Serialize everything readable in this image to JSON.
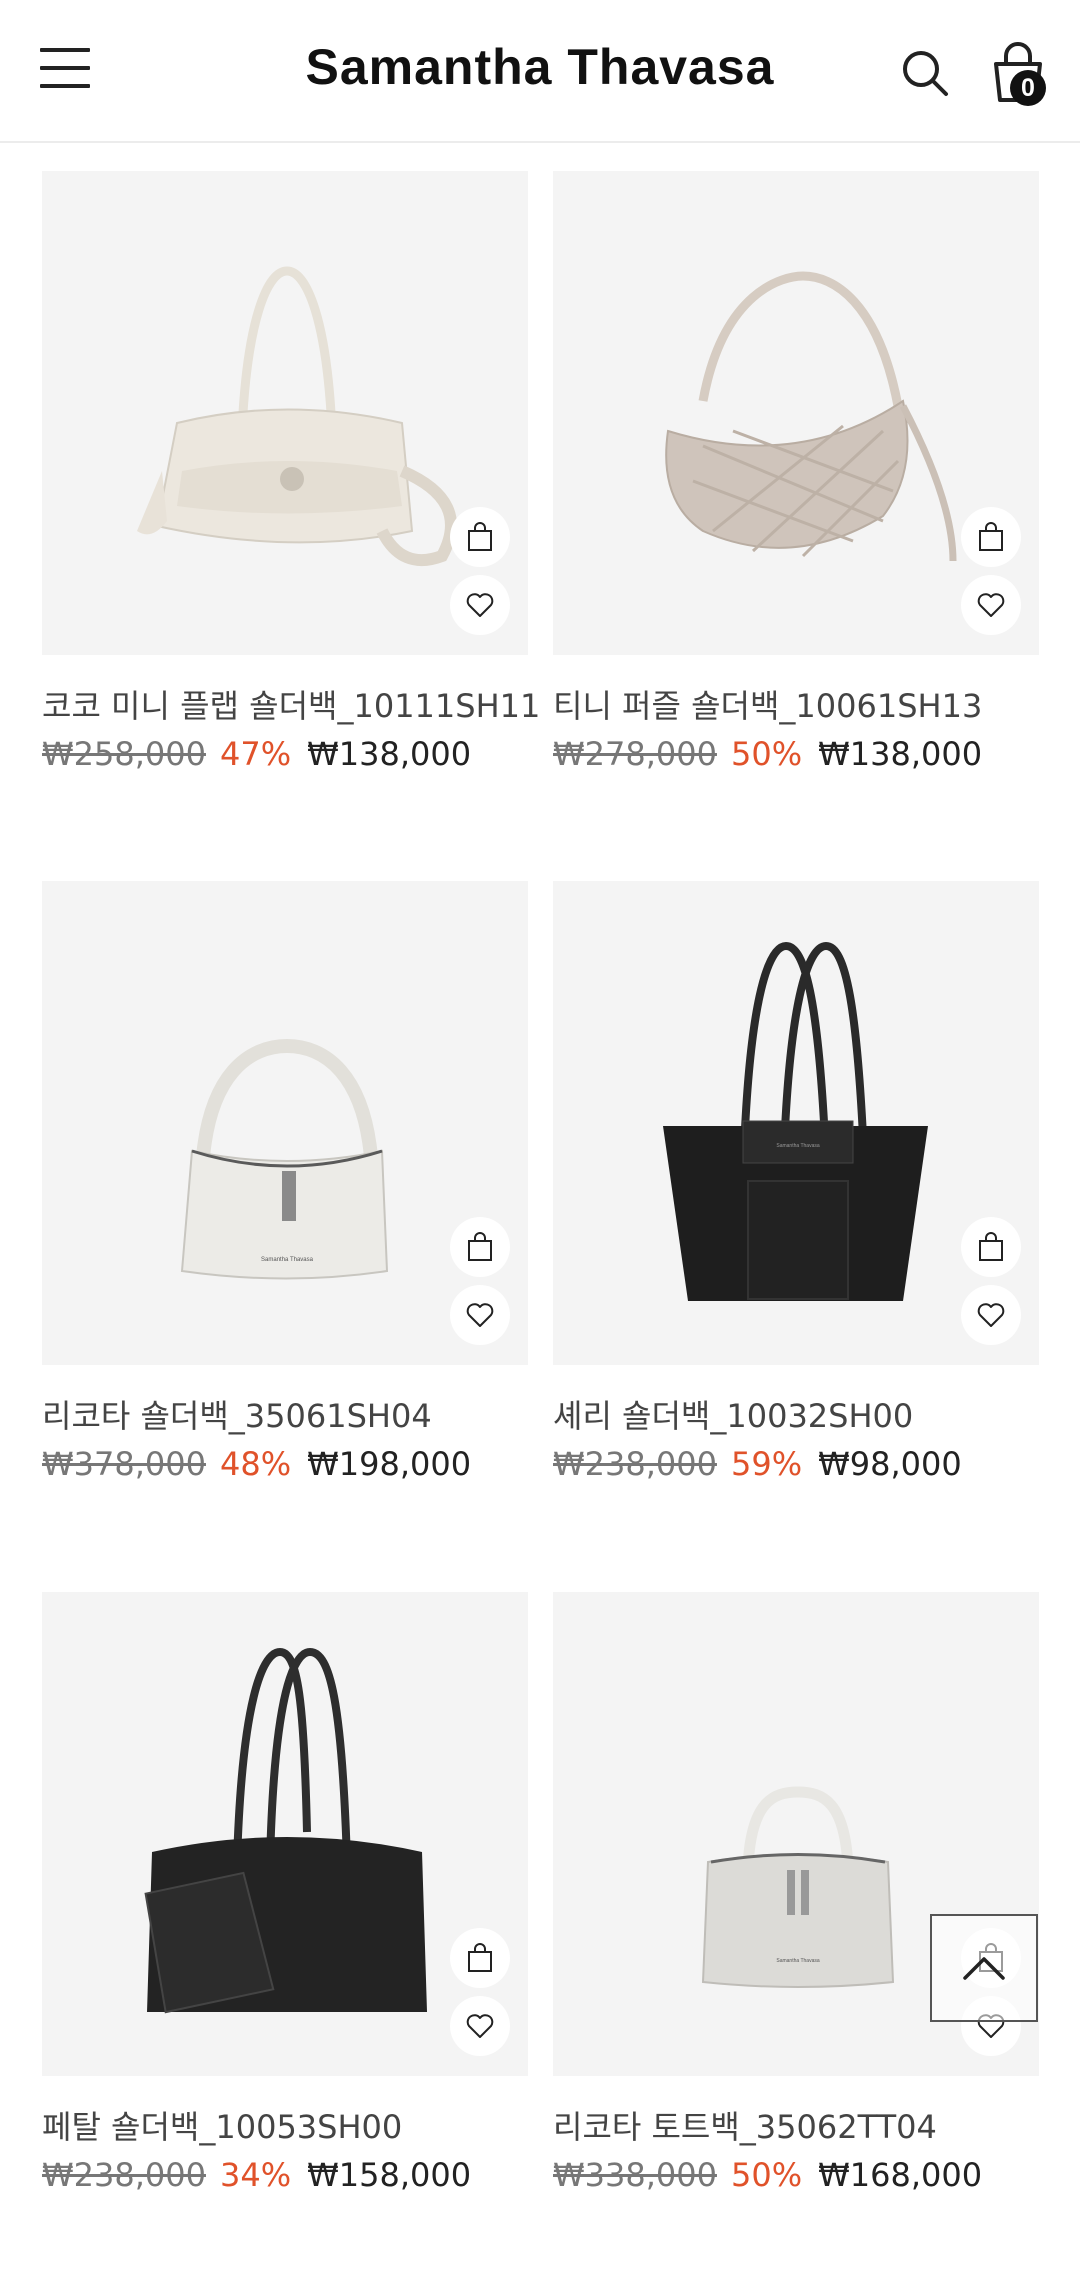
{
  "header": {
    "logo": "Samantha Thavasa",
    "cart_count": "0"
  },
  "products": [
    {
      "name": "코코 미니 플랩 숄더백_10111SH11",
      "original_price": "₩258,000",
      "discount": "47%",
      "sale_price": "₩138,000",
      "color": "#ece7de"
    },
    {
      "name": "티니 퍼즐 숄더백_10061SH13",
      "original_price": "₩278,000",
      "discount": "50%",
      "sale_price": "₩138,000",
      "color": "#cfc4bb"
    },
    {
      "name": "리코타 숄더백_35061SH04",
      "original_price": "₩378,000",
      "discount": "48%",
      "sale_price": "₩198,000",
      "color": "#ecebe7"
    },
    {
      "name": "셰리 숄더백_10032SH00",
      "original_price": "₩238,000",
      "discount": "59%",
      "sale_price": "₩98,000",
      "color": "#1e1e1e"
    },
    {
      "name": "페탈 숄더백_10053SH00",
      "original_price": "₩238,000",
      "discount": "34%",
      "sale_price": "₩158,000",
      "color": "#232323"
    },
    {
      "name": "리코타 토트백_35062TT04",
      "original_price": "₩338,000",
      "discount": "50%",
      "sale_price": "₩168,000",
      "color": "#dcdbd7"
    }
  ],
  "colors": {
    "accent_discount": "#e0522a",
    "thumb_bg": "#f4f4f4"
  },
  "icons": [
    "menu-icon",
    "search-icon",
    "shopping-bag-icon",
    "heart-icon",
    "chevron-up-icon"
  ]
}
